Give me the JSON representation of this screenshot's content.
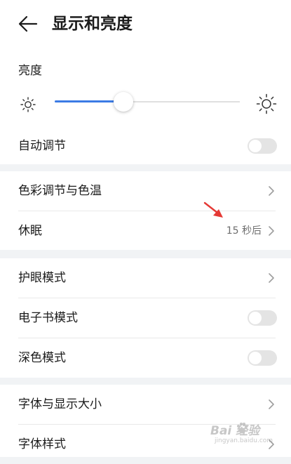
{
  "header": {
    "title": "显示和亮度"
  },
  "brightness": {
    "label": "亮度",
    "level_percent": 37
  },
  "auto_adjust": {
    "label": "自动调节",
    "enabled": false
  },
  "section2": {
    "color_temp": {
      "label": "色彩调节与色温"
    },
    "sleep": {
      "label": "休眠",
      "value": "15 秒后"
    }
  },
  "section3": {
    "eye_comfort": {
      "label": "护眼模式"
    },
    "ebook_mode": {
      "label": "电子书模式",
      "enabled": false
    },
    "dark_mode": {
      "label": "深色模式",
      "enabled": false
    }
  },
  "section4": {
    "font_size": {
      "label": "字体与显示大小"
    },
    "font_style": {
      "label": "字体样式"
    }
  },
  "watermark": {
    "main": "Bai 经验",
    "sub": "jingyan.baidu.com"
  },
  "colors": {
    "accent": "#3b7be5",
    "annotation": "#e53935",
    "background": "#f1f3f5"
  },
  "icons": [
    "arrow-left-icon",
    "sun-small-icon",
    "sun-large-icon",
    "chevron-right-icon",
    "toggle-switch",
    "red-annotation-arrow"
  ]
}
